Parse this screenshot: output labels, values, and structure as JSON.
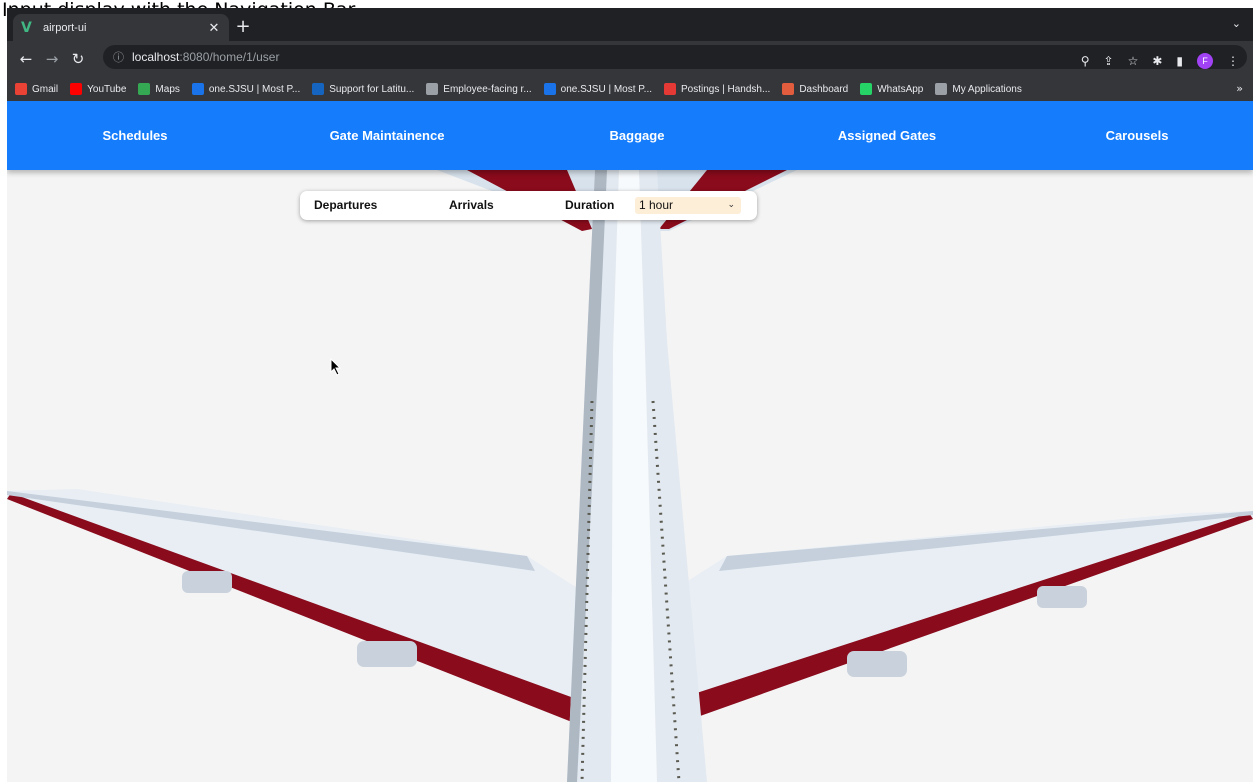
{
  "caption": "Input display with the Navigation Bar",
  "browser": {
    "tab": {
      "title": "airport-ui",
      "favicon": "vue-logo-icon"
    },
    "url": {
      "host": "localhost",
      "rest": ":8080/home/1/user"
    },
    "bookmarks": [
      {
        "label": "Gmail",
        "color": "#ea4335"
      },
      {
        "label": "YouTube",
        "color": "#ff0000"
      },
      {
        "label": "Maps",
        "color": "#34a853"
      },
      {
        "label": "one.SJSU | Most P...",
        "color": "#1a73e8"
      },
      {
        "label": "Support for Latitu...",
        "color": "#1565c0"
      },
      {
        "label": "Employee-facing r...",
        "color": "#9aa0a6"
      },
      {
        "label": "one.SJSU | Most P...",
        "color": "#1a73e8"
      },
      {
        "label": "Postings | Handsh...",
        "color": "#e53935"
      },
      {
        "label": "Dashboard",
        "color": "#e25c3e"
      },
      {
        "label": "WhatsApp",
        "color": "#25d366"
      },
      {
        "label": "My Applications",
        "color": "#9aa0a6"
      }
    ],
    "profile_initial": "F"
  },
  "nav": {
    "schedules": "Schedules",
    "gate_maintainence": "Gate Maintainence",
    "baggage": "Baggage",
    "assigned_gates": "Assigned Gates",
    "carousels": "Carousels",
    "color": "#157dfc"
  },
  "filter": {
    "departures": "Departures",
    "arrivals": "Arrivals",
    "duration_label": "Duration",
    "duration_value": "1 hour"
  },
  "colors": {
    "plane_stripe": "#8a0b1c",
    "background": "#f4f4f4"
  }
}
